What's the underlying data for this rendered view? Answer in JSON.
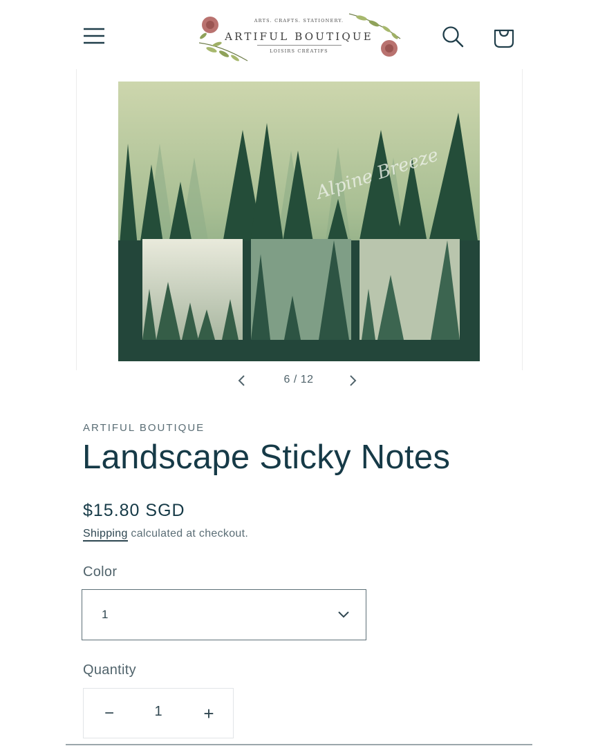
{
  "header": {
    "menu_icon": "hamburger-menu-icon",
    "search_icon": "search-icon",
    "cart_icon": "shopping-bag-icon",
    "logo": {
      "tagline_top": "ARTS. CRAFTS. STATIONERY.",
      "name": "ARTIFUL BOUTIQUE",
      "tagline_bottom": "LOISIRS CRÉATIFS"
    }
  },
  "gallery": {
    "image_caption": "Alpine Breeze",
    "pager": "6 / 12",
    "prev_icon": "chevron-left-icon",
    "next_icon": "chevron-right-icon"
  },
  "product": {
    "vendor": "ARTIFUL BOUTIQUE",
    "title": "Landscape Sticky Notes",
    "price": "$15.80 SGD",
    "shipping_link": "Shipping",
    "shipping_text": " calculated at checkout."
  },
  "options": {
    "color_label": "Color",
    "color_value": "1",
    "dropdown_icon": "chevron-down-icon"
  },
  "quantity": {
    "label": "Quantity",
    "value": "1",
    "minus": "−",
    "plus": "+"
  },
  "colors": {
    "text_dark": "#163a47",
    "text_muted": "#5a6d75",
    "forest_light": "#c9d3a9",
    "forest_dark": "#1f4a34"
  }
}
